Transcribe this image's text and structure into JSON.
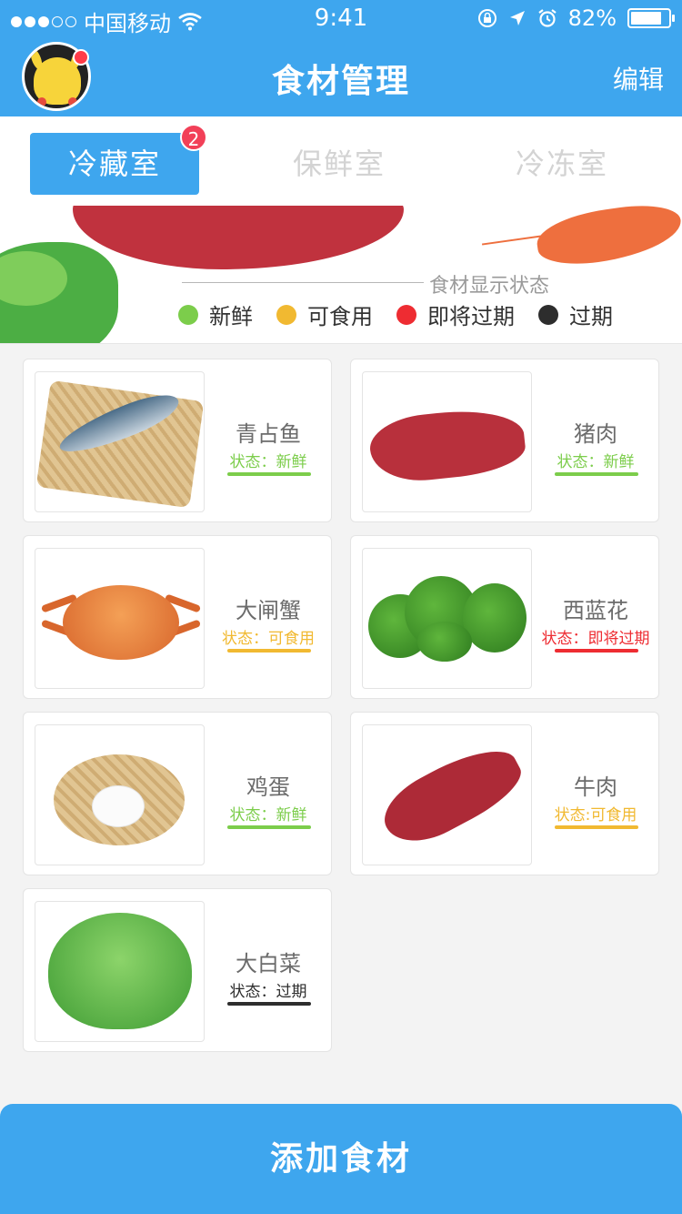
{
  "status_bar": {
    "carrier": "中国移动",
    "time": "9:41",
    "battery": "82%",
    "battery_level": 0.82,
    "signal_icon": "signal-dots-icon",
    "wifi_icon": "wifi-icon",
    "lock_icon": "orientation-lock-icon",
    "location_icon": "location-arrow-icon",
    "alarm_icon": "alarm-icon"
  },
  "header": {
    "title": "食材管理",
    "edit_label": "编辑",
    "avatar_icon": "pikachu-avatar"
  },
  "tabs": [
    {
      "label": "冷藏室",
      "active": true,
      "badge": "2"
    },
    {
      "label": "保鲜室",
      "active": false
    },
    {
      "label": "冷冻室",
      "active": false
    }
  ],
  "legend": {
    "title": "食材显示状态",
    "items": [
      {
        "label": "新鲜",
        "color": "#7ccd4b"
      },
      {
        "label": "可食用",
        "color": "#f1b931"
      },
      {
        "label": "即将过期",
        "color": "#ee2c32"
      },
      {
        "label": "过期",
        "color": "#2d2d2d"
      }
    ]
  },
  "foods": [
    {
      "name": "青占鱼",
      "status": "状态：新鲜",
      "color": "#7ccd4b",
      "image": "mackerel-on-bamboo-tray"
    },
    {
      "name": "猪肉",
      "status": "状态：新鲜",
      "color": "#7ccd4b",
      "image": "pork-slab"
    },
    {
      "name": "大闸蟹",
      "status": "状态：可食用",
      "color": "#f1b931",
      "image": "crab"
    },
    {
      "name": "西蓝花",
      "status": "状态：即将过期",
      "color": "#ee2c32",
      "image": "broccoli"
    },
    {
      "name": "鸡蛋",
      "status": "状态：新鲜",
      "color": "#7ccd4b",
      "image": "egg-in-basket"
    },
    {
      "name": "牛肉",
      "status": "状态:可食用",
      "color": "#f1b931",
      "image": "beef-steak"
    },
    {
      "name": "大白菜",
      "status": "状态：过期",
      "color": "#2d2d2d",
      "image": "lettuce"
    }
  ],
  "add_button_label": "添加食材",
  "colors": {
    "brand": "#3ea6ee",
    "badge": "#f24058"
  }
}
